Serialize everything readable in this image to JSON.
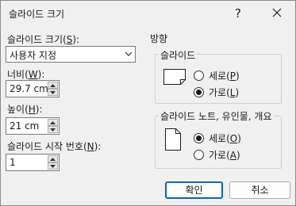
{
  "window": {
    "title": "슬라이드 크기",
    "help_glyph": "?"
  },
  "size": {
    "label": "슬라이드 크기(",
    "label_key": "S",
    "label_end": "):",
    "value": "사용자 지정"
  },
  "width": {
    "label": "너비(",
    "label_key": "W",
    "label_end": "):",
    "value": "29.7 cm"
  },
  "height": {
    "label": "높이(",
    "label_key": "H",
    "label_end": "):",
    "value": "21 cm"
  },
  "start_number": {
    "label": "슬라이드 시작 번호(",
    "label_key": "N",
    "label_end": "):",
    "value": "1"
  },
  "orientation": {
    "caption": "방향",
    "slides": {
      "caption": "슬라이드",
      "portrait": {
        "label": "세로(",
        "key": "P",
        "end": ")",
        "selected": false
      },
      "landscape": {
        "label": "가로(",
        "key": "L",
        "end": ")",
        "selected": true
      }
    },
    "notes": {
      "caption": "슬라이드 노트, 유인물, 개요",
      "portrait": {
        "label": "세로(",
        "key": "O",
        "end": ")",
        "selected": true
      },
      "landscape": {
        "label": "가로(",
        "key": "A",
        "end": ")",
        "selected": false
      }
    }
  },
  "buttons": {
    "ok": "확인",
    "cancel": "취소"
  },
  "colors": {
    "accent": "#0067c0",
    "background": "#f0f0f0"
  }
}
